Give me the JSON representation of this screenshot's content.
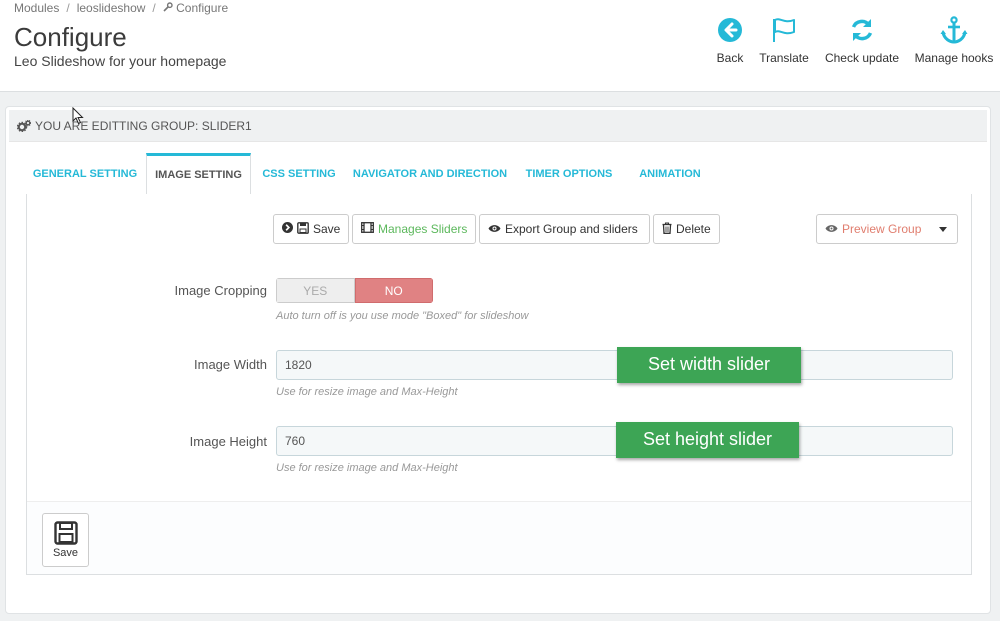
{
  "breadcrumb": {
    "items": [
      "Modules",
      "leoslideshow",
      "Configure"
    ]
  },
  "header": {
    "title": "Configure",
    "subtitle": "Leo Slideshow for your homepage"
  },
  "toolbar": {
    "back": "Back",
    "translate": "Translate",
    "check_update": "Check update",
    "manage_hooks": "Manage hooks",
    "accent_color": "#25b9d7"
  },
  "panel": {
    "heading": "YOU ARE EDITTING GROUP: SLIDER1"
  },
  "tabs": [
    {
      "label": "GENERAL SETTING"
    },
    {
      "label": "IMAGE SETTING",
      "active": true
    },
    {
      "label": "CSS SETTING"
    },
    {
      "label": "NAVIGATOR AND DIRECTION"
    },
    {
      "label": "TIMER OPTIONS"
    },
    {
      "label": "ANIMATION"
    }
  ],
  "actions": {
    "save": "Save",
    "manage_sliders": "Manages Sliders",
    "export": "Export Group and sliders",
    "delete": "Delete",
    "preview": "Preview Group"
  },
  "form": {
    "image_cropping": {
      "label": "Image Cropping",
      "yes": "YES",
      "no": "NO",
      "selected": "NO",
      "help": "Auto turn off is you use mode \"Boxed\" for slideshow"
    },
    "image_width": {
      "label": "Image Width",
      "value": "1820",
      "help": "Use for resize image and Max-Height"
    },
    "image_height": {
      "label": "Image Height",
      "value": "760",
      "help": "Use for resize image and Max-Height"
    }
  },
  "annotations": {
    "width": "Set width slider",
    "height": "Set height slider",
    "color": "#3da555"
  },
  "footer": {
    "save": "Save"
  }
}
